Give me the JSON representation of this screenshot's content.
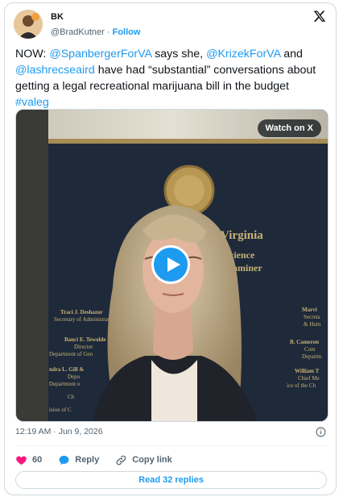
{
  "author": {
    "display_name": "BK",
    "handle": "@BradKutner",
    "separator": "·",
    "follow_label": "Follow"
  },
  "tweet": {
    "t1": "NOW: ",
    "m1": "@SpanbergerForVA",
    "t2": " says she, ",
    "m2": "@KrizekForVA",
    "t3": " and ",
    "m3": "@lashrecseaird",
    "t4": " have had “substantial” conversations about getting a legal recreational marijuana bill in the budget ",
    "h1": "#valeg"
  },
  "video": {
    "watch_label": "Watch on X",
    "wall_text": {
      "line1": "of Virginia",
      "line2": "c Science",
      "line3": "Examiner",
      "name1": "Traci J. Deshazor",
      "role1": "Secretary of Administrati",
      "name2": "Banci E. Tewolde",
      "role2": "Director",
      "role2b": "Department of Gen",
      "name3": "ndra L. Gill &",
      "role3": "Depu",
      "role3b": "Department o",
      "role3c": "Ch",
      "role3d": "ision of C",
      "rname1": "Marvi",
      "rrole1": "Secreta",
      "rrole1b": "& Hum",
      "rname2": "B. Cameron",
      "rrole2": "Com",
      "rrole2b": "Departm",
      "rname3": "William T",
      "rrole3": "Chief Me",
      "rrole3b": "ice of the Ch"
    }
  },
  "meta": {
    "timestamp": "12:19 AM · Jun 9, 2026"
  },
  "actions": {
    "like_count": "60",
    "reply_label": "Reply",
    "copy_label": "Copy link"
  },
  "read_replies_label": "Read 32 replies",
  "colors": {
    "accent": "#1d9bf0",
    "like": "#f91880",
    "muted": "#536471"
  }
}
